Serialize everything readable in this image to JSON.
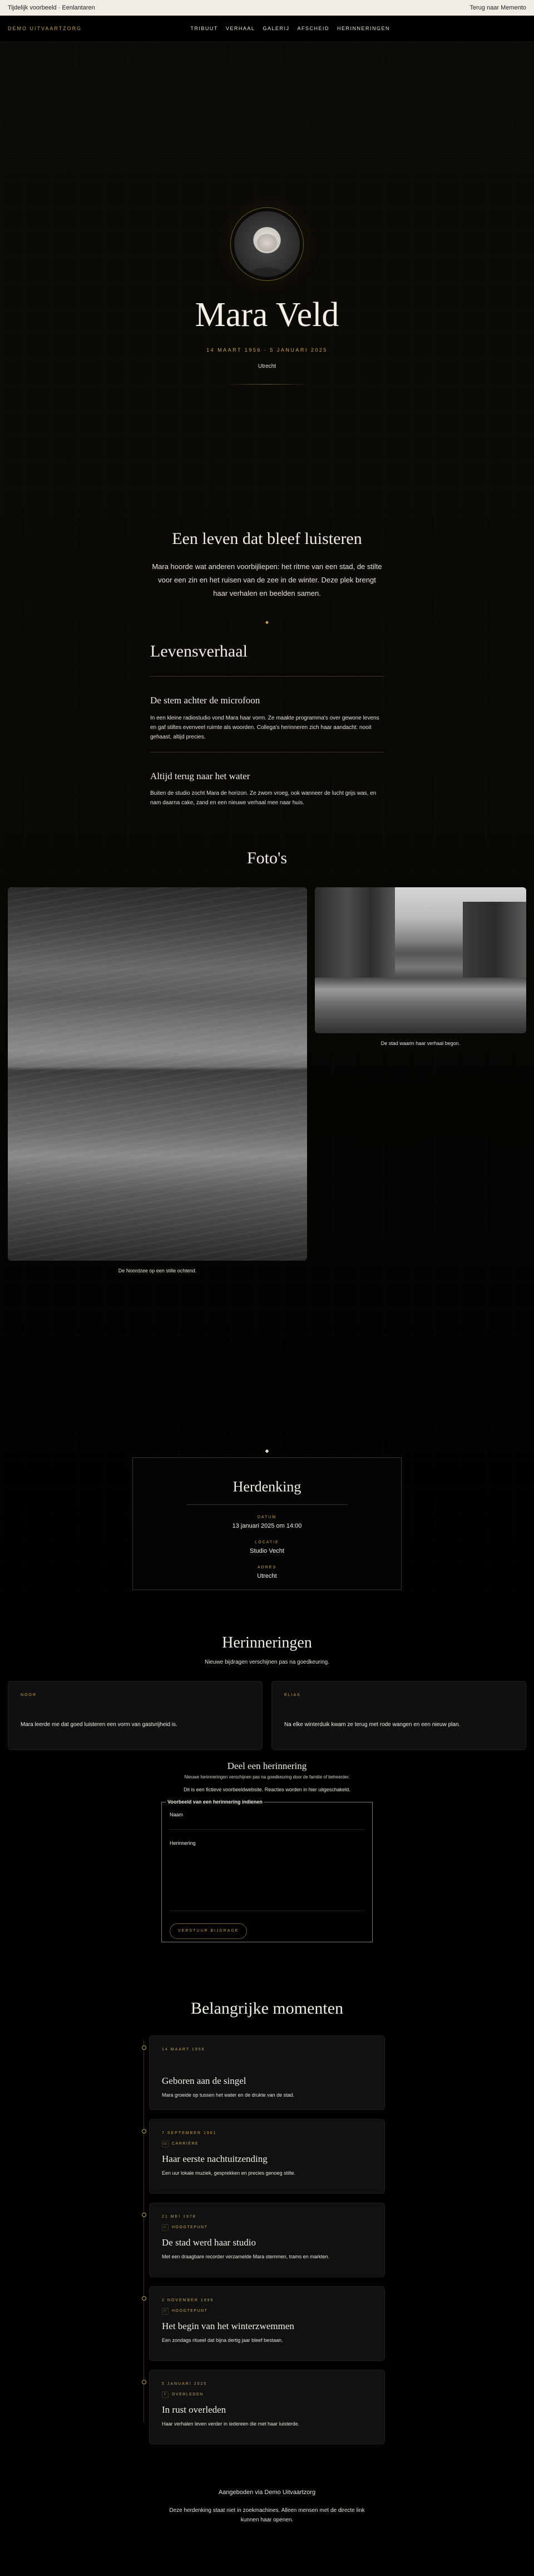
{
  "preview_bar": {
    "left": "Tijdelijk voorbeeld · Eenlantaren",
    "right": "Terug naar Memento"
  },
  "nav": {
    "brand": "Demo Uitvaartzorg",
    "links": [
      "Tribuut",
      "Verhaal",
      "Galerij",
      "Afscheid",
      "Herinneringen"
    ]
  },
  "hero": {
    "name": "Mara Veld",
    "dates": "14 maart 1956 · 5 januari 2025",
    "place": "Utrecht"
  },
  "intro": {
    "title": "Een leven dat bleef luisteren",
    "text": "Mara hoorde wat anderen voorbijliepen: het ritme van een stad, de stilte voor een zin en het ruisen van de zee in de winter. Deze plek brengt haar verhalen en beelden samen."
  },
  "story": {
    "title": "Levensverhaal",
    "chapters": [
      {
        "title": "De stem achter de microfoon",
        "text": "In een kleine radiostudio vond Mara haar vorm. Ze maakte programma's over gewone levens en gaf stiltes evenveel ruimte als woorden. Collega's herinneren zich haar aandacht: nooit gehaast, altijd precies."
      },
      {
        "title": "Altijd terug naar het water",
        "text": "Buiten de studio zocht Mara de horizon. Ze zwom vroeg, ook wanneer de lucht grijs was, en nam daarna cake, zand en een nieuwe verhaal mee naar huis."
      }
    ]
  },
  "photos": {
    "title": "Foto's",
    "items": [
      {
        "caption": "De Noordzee op een stille ochtend."
      },
      {
        "caption": "De stad waarin haar verhaal begon."
      }
    ]
  },
  "service": {
    "title": "Herdenking",
    "rows": [
      {
        "label": "Datum",
        "value": "13 januari 2025 om 14:00"
      },
      {
        "label": "Locatie",
        "value": "Studio Vecht"
      },
      {
        "label": "Adres",
        "value": "Utrecht"
      }
    ]
  },
  "memories": {
    "title": "Herinneringen",
    "subtitle": "Nieuwe bijdragen verschijnen pas na goedkeuring.",
    "items": [
      {
        "author": "Noor",
        "text": "Mara leerde me dat goed luisteren een vorm van gastvrijheid is."
      },
      {
        "author": "Elias",
        "text": "Na elke winterduik kwam ze terug met rode wangen en een nieuw plan."
      }
    ],
    "share": {
      "title": "Deel een herinnering",
      "note1": "Nieuwe herinneringen verschijnen pas na goedkeuring door de familie of beheerder.",
      "note2": "Dit is een fictieve voorbeeldwebsite. Reacties worden in hier uitgeschakeld.",
      "legend": "Voorbeeld van een herinnering indienen",
      "name_label": "Naam",
      "memory_label": "Herinnering",
      "submit": "Verstuur bijdrage"
    }
  },
  "timeline": {
    "title": "Belangrijke momenten",
    "items": [
      {
        "date": "14 maart 1956",
        "tag": "",
        "icon": "",
        "title": "Geboren aan de singel",
        "text": "Mara groeide op tussen het water en de drukte van de stad."
      },
      {
        "date": "7 september 1981",
        "tag": "Carrière",
        "icon": "briefcase-icon",
        "title": "Haar eerste nachtuitzending",
        "text": "Een uur lokale muziek, gesprekken en precies genoeg stilte."
      },
      {
        "date": "21 mei 1978",
        "tag": "Hoogtepunt",
        "icon": "star-icon",
        "title": "De stad werd haar studio",
        "text": "Met een draagbare recorder verzamelde Mara stemmen, trams en markten."
      },
      {
        "date": "2 november 1996",
        "tag": "Hoogtepunt",
        "icon": "star-icon",
        "title": "Het begin van het winterzwemmen",
        "text": "Een zondags ritueel dat bijna dertig jaar bleef bestaan."
      },
      {
        "date": "5 januari 2025",
        "tag": "Overleden",
        "icon": "candle-icon",
        "title": "In rust overleden",
        "text": "Haar verhalen leven verder in iedereen die met haar luisterde."
      }
    ]
  },
  "footer": {
    "by": "Aangeboden via Demo Uitvaartzorg",
    "info": "Deze herdenking staat niet in zoekmachines. Alleen mensen met de directe link kunnen haar openen."
  }
}
